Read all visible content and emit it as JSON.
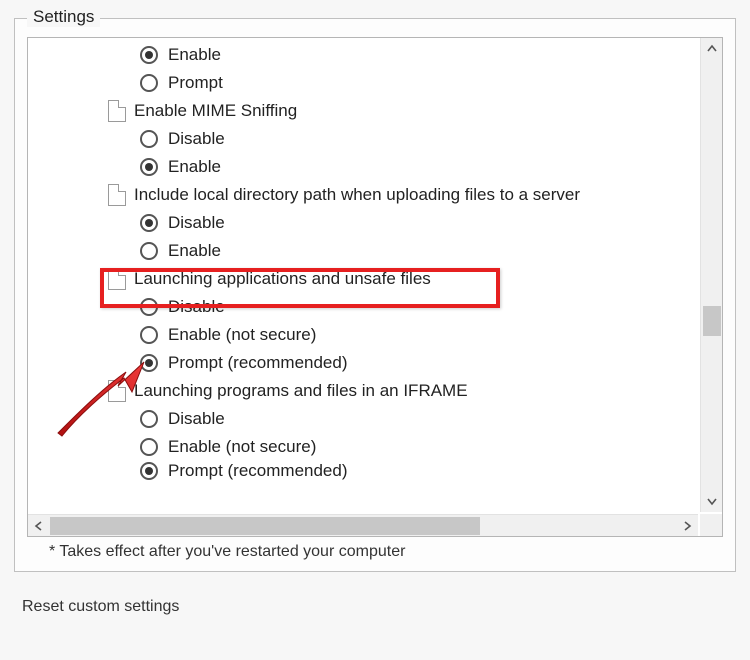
{
  "group_title": "Settings",
  "footnote": "* Takes effect after you've restarted your computer",
  "reset_section_label": "Reset custom settings",
  "tree": {
    "orphan_top": [
      {
        "label": "Enable",
        "checked": true
      },
      {
        "label": "Prompt",
        "checked": false
      }
    ],
    "sections": [
      {
        "title": "Enable MIME Sniffing",
        "options": [
          {
            "label": "Disable",
            "checked": false
          },
          {
            "label": "Enable",
            "checked": true
          }
        ]
      },
      {
        "title": "Include local directory path when uploading files to a server",
        "options": [
          {
            "label": "Disable",
            "checked": true
          },
          {
            "label": "Enable",
            "checked": false
          }
        ]
      },
      {
        "title": "Launching applications and unsafe files",
        "highlighted": true,
        "options": [
          {
            "label": "Disable",
            "checked": false
          },
          {
            "label": "Enable (not secure)",
            "checked": false
          },
          {
            "label": "Prompt (recommended)",
            "checked": true,
            "arrow_target": true
          }
        ]
      },
      {
        "title": "Launching programs and files in an IFRAME",
        "options": [
          {
            "label": "Disable",
            "checked": false
          },
          {
            "label": "Enable (not secure)",
            "checked": false
          },
          {
            "label": "Prompt (recommended)",
            "checked": true
          }
        ]
      }
    ]
  }
}
